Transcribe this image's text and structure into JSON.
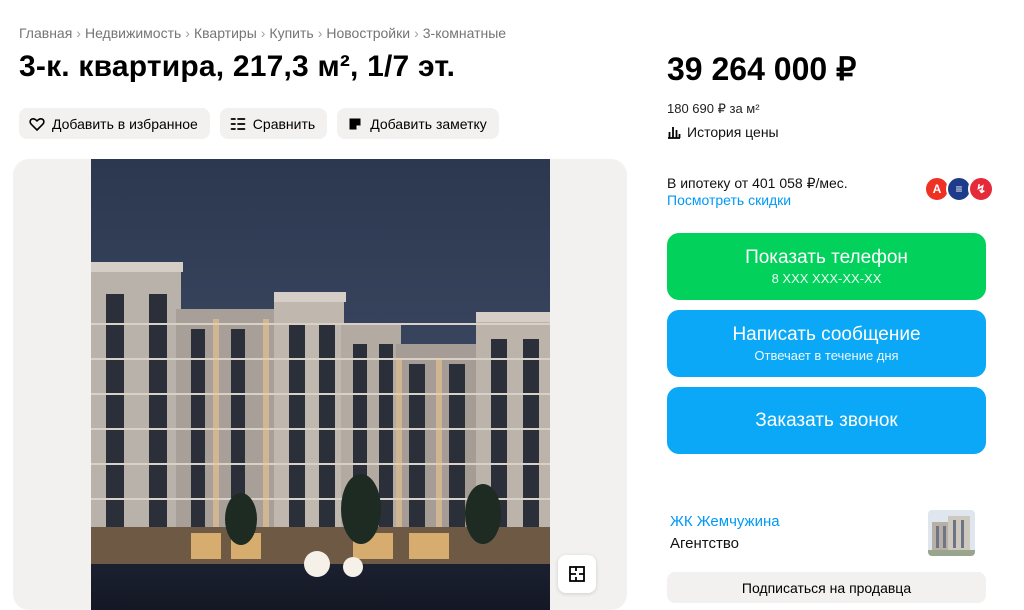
{
  "breadcrumbs": [
    "Главная",
    "Недвижимость",
    "Квартиры",
    "Купить",
    "Новостройки",
    "3-комнатные"
  ],
  "breadcrumb_separator": "›",
  "title": "3-к. квартира, 217,3 м², 1/7 эт.",
  "actions": {
    "favorite": "Добавить в избранное",
    "compare": "Сравнить",
    "note": "Добавить заметку"
  },
  "gallery": {
    "photo_alt": "Жилой комплекс вечером",
    "plan_icon": "floor-plan-icon"
  },
  "price": {
    "total": "39 264 000 ₽",
    "per_sqm": "180 690 ₽ за м²",
    "history": "История цены"
  },
  "mortgage": {
    "text": "В ипотеку от 401 058 ₽/мес.",
    "discount_link": "Посмотреть скидки",
    "banks": [
      {
        "name": "alfa-bank-icon",
        "color": "#ef3124",
        "glyph": "А"
      },
      {
        "name": "bank-2-icon",
        "color": "#1e3a8a",
        "glyph": "≡"
      },
      {
        "name": "bank-3-icon",
        "color": "#e52b3a",
        "glyph": "↯"
      }
    ]
  },
  "contact": {
    "phone_label": "Показать телефон",
    "phone_mask": "8 XXX XXX-XX-XX",
    "message_label": "Написать сообщение",
    "message_sub": "Отвечает в течение дня",
    "callback_label": "Заказать звонок"
  },
  "seller": {
    "name": "ЖК Жемчужина",
    "type": "Агентство",
    "subscribe": "Подписаться на продавца"
  },
  "colors": {
    "green": "#02d15c",
    "blue": "#0aa8f7",
    "link": "#0099f7",
    "button_gray": "#f2f1f0"
  }
}
